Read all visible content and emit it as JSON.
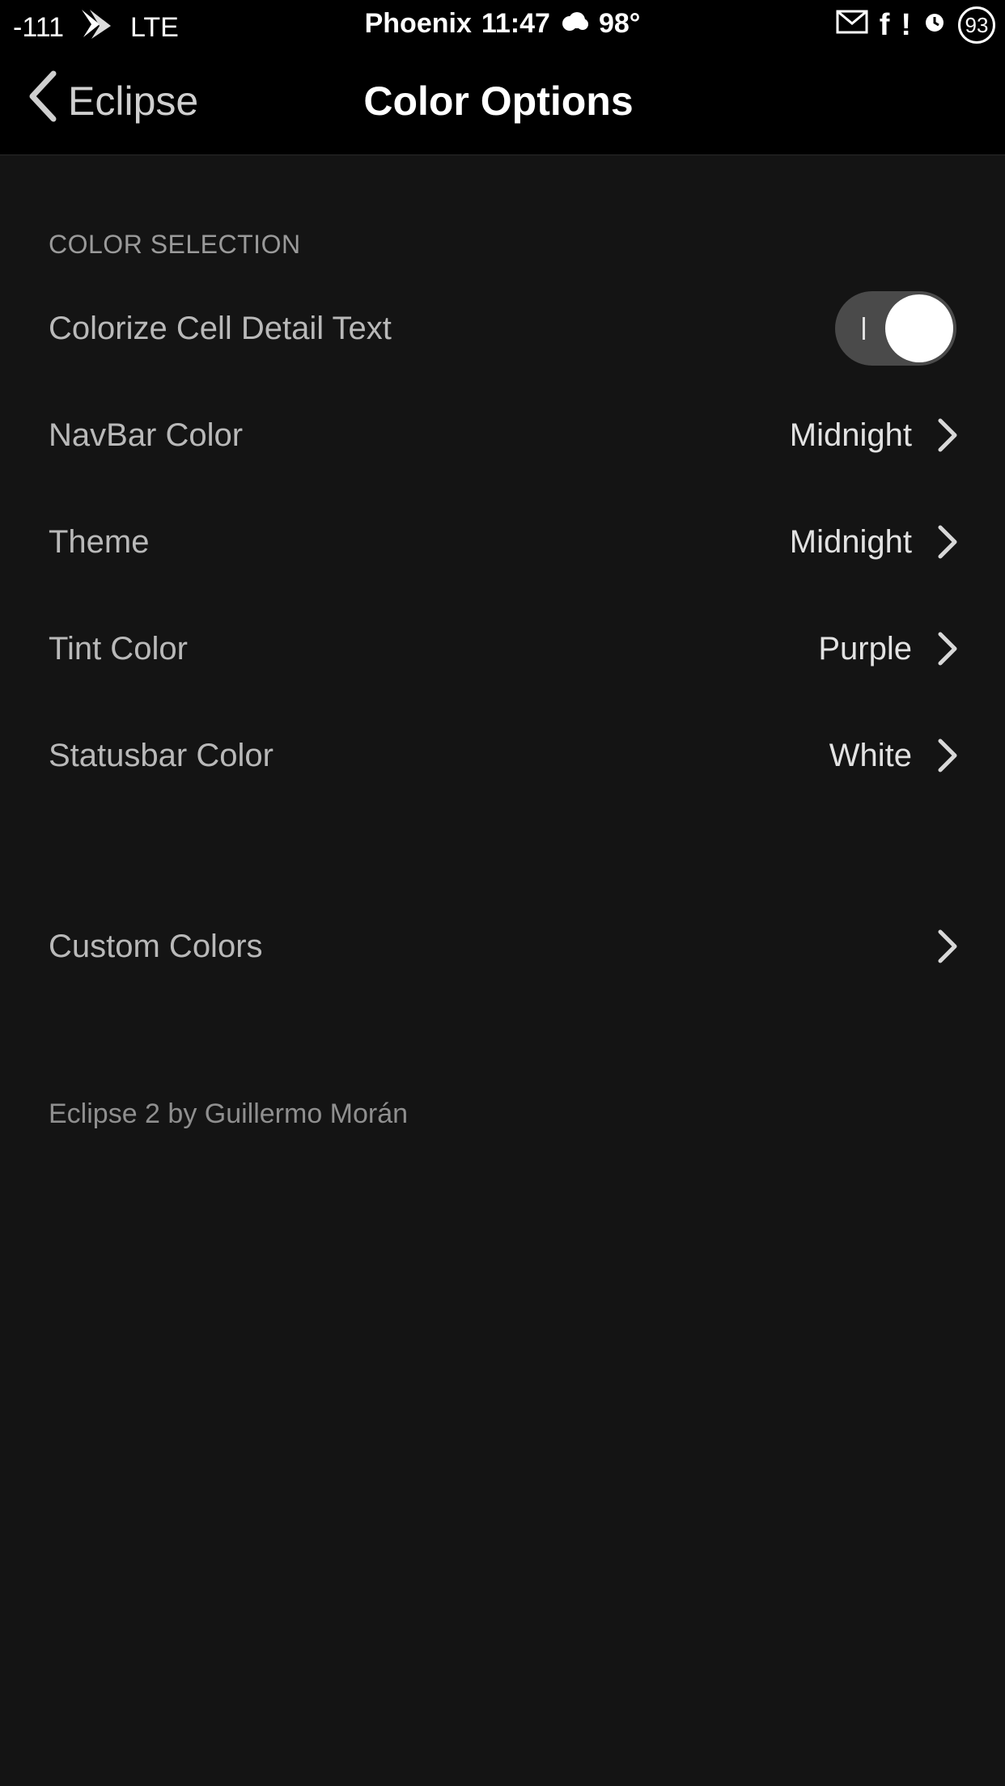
{
  "status_bar": {
    "signal": "-111",
    "network": "LTE",
    "city": "Phoenix",
    "time": "11:47",
    "temperature": "98°",
    "battery": "93"
  },
  "nav": {
    "back_label": "Eclipse",
    "title": "Color Options"
  },
  "section": {
    "header": "COLOR SELECTION"
  },
  "rows": {
    "colorize": {
      "label": "Colorize Cell Detail Text",
      "toggle_on": true
    },
    "navbar_color": {
      "label": "NavBar Color",
      "value": "Midnight"
    },
    "theme": {
      "label": "Theme",
      "value": "Midnight"
    },
    "tint_color": {
      "label": "Tint Color",
      "value": "Purple"
    },
    "statusbar_color": {
      "label": "Statusbar Color",
      "value": "White"
    },
    "custom_colors": {
      "label": "Custom Colors"
    }
  },
  "footer": "Eclipse 2 by Guillermo Morán",
  "colors": {
    "background": "#141414",
    "bar_background": "#000000",
    "label": "#b9b9b9",
    "value": "#e2e2e2"
  }
}
